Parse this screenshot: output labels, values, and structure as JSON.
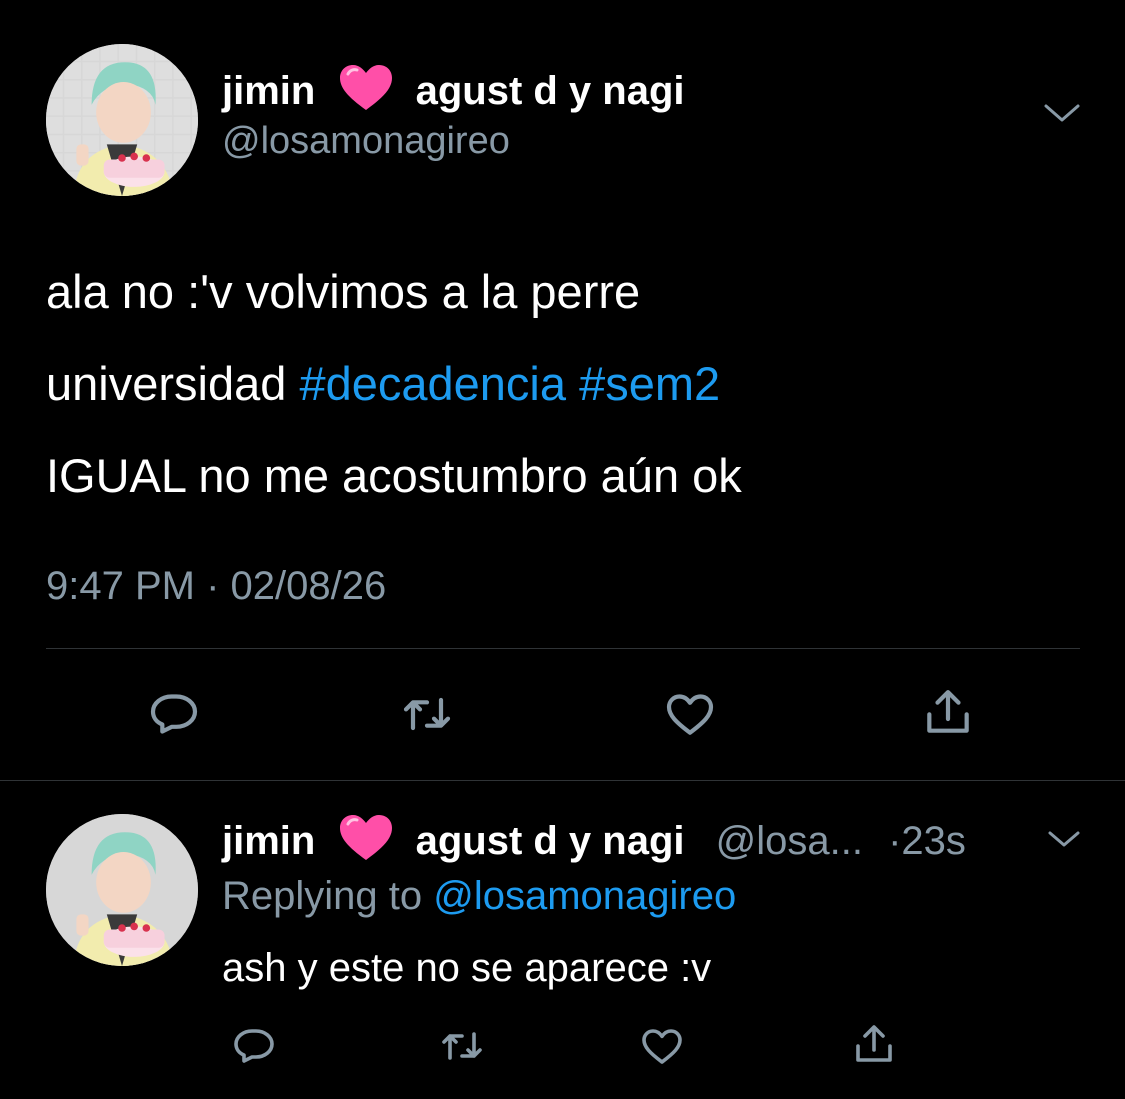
{
  "tweet": {
    "name_first": "jimin",
    "name_emoji": "heart-icon",
    "name_rest": "agust d y nagi",
    "handle": "@losamonagireo",
    "body_line1": "ala no :'v volvimos a la perre",
    "body_line2_text": "universidad ",
    "hashtag1": "#decadencia",
    "hashtag2": "#sem2",
    "body_line3": "IGUAL no me acostumbro aún ok",
    "time": "9:47 PM",
    "separator": "·",
    "date": "02/08/26"
  },
  "reply": {
    "name_first": "jimin",
    "name_rest": "agust d y nagi",
    "handle_truncated": "@losa...",
    "time_ago": "·23s",
    "replying_prefix": "Replying to ",
    "replying_handle": "@losamonagireo",
    "body": "ash y este no se aparece :v"
  },
  "icons": {
    "reply": "reply-icon",
    "retweet": "retweet-icon",
    "like": "heart-outline-icon",
    "share": "share-icon",
    "more": "chevron-down-icon"
  },
  "colors": {
    "background": "#000000",
    "text": "#ffffff",
    "secondary": "#8899a6",
    "link": "#1d9bf0",
    "heart_emoji": "#ff4fa8",
    "divider": "#2f3336"
  }
}
